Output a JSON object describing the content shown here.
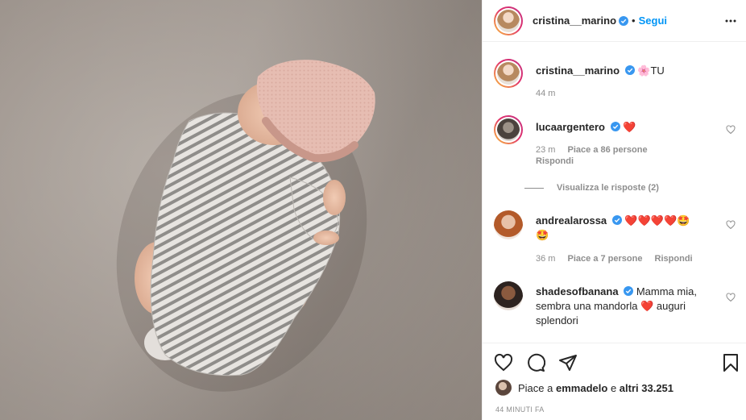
{
  "post": {
    "author": "cristina__marino",
    "dot": "•",
    "follow_label": "Segui",
    "caption_emoji": "🌸",
    "caption": "TU",
    "caption_time": "44 m",
    "likes_prefix": "Piace a",
    "likes_user": "emmadelo",
    "likes_joiner": "e",
    "likes_others": "altri 33.251",
    "posted_ago": "44 MINUTI FA"
  },
  "comments": [
    {
      "user": "lucaargentero",
      "text": "❤️",
      "time": "23 m",
      "likes": "Piace a 86 persone",
      "reply": "Rispondi",
      "view_replies": "Visualizza le risposte (2)"
    },
    {
      "user": "andrealarossa",
      "text": "❤️❤️❤️❤️🤩",
      "text2": "🤩",
      "time": "36 m",
      "likes": "Piace a 7 persone",
      "reply": "Rispondi"
    },
    {
      "user": "shadesofbanana",
      "text": "Mamma mia, sembra una mandorla ❤️ auguri splendori"
    }
  ],
  "icons": {
    "verified": "verified-badge-icon",
    "more": "more-options-icon",
    "like": "heart-icon",
    "comment": "comment-icon",
    "share": "share-icon",
    "save": "bookmark-icon"
  },
  "colors": {
    "accent_blue": "#0095f6",
    "muted": "#8e8e8e",
    "text": "#262626"
  }
}
